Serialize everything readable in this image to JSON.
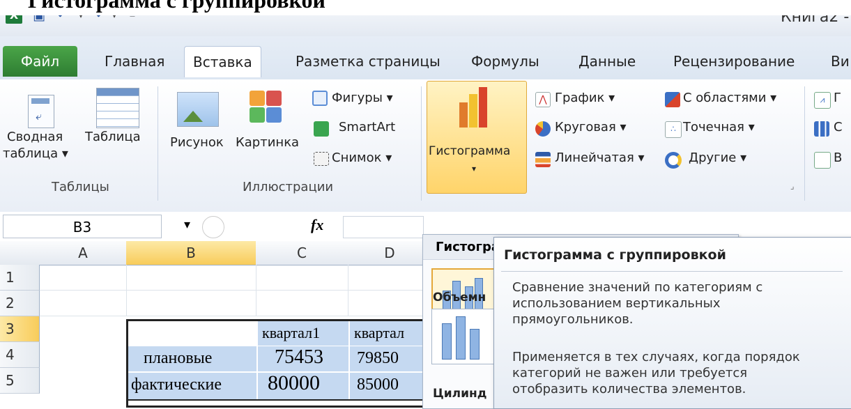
{
  "caption": "Гистограмма с группировкой",
  "titlebar": {
    "book_title": "Книга2 -"
  },
  "quick_access": {
    "icons": [
      "excel-logo-icon",
      "save-icon",
      "undo-icon",
      "redo-icon",
      "customize-icon"
    ]
  },
  "tabs": [
    {
      "label": "Файл"
    },
    {
      "label": "Главная"
    },
    {
      "label": "Вставка",
      "active": true
    },
    {
      "label": "Разметка страницы"
    },
    {
      "label": "Формулы"
    },
    {
      "label": "Данные"
    },
    {
      "label": "Рецензирование"
    },
    {
      "label": "Ви"
    }
  ],
  "ribbon": {
    "tables": {
      "pivot_line1": "Сводная",
      "pivot_line2": "таблица ▾",
      "table": "Таблица",
      "group": "Таблицы"
    },
    "illustrations": {
      "picture": "Рисунок",
      "clipart": "Картинка",
      "shapes": "Фигуры ▾",
      "smartart": "SmartArt",
      "screenshot": "Снимок ▾",
      "group": "Иллюстрации"
    },
    "charts": {
      "histogram": "Гистограмма",
      "histogram_arrow": "▾",
      "line": "График ▾",
      "pie": "Круговая ▾",
      "bar": "Линейчатая ▾",
      "area": "С областями ▾",
      "scatter": "Точечная ▾",
      "other": "Другие ▾",
      "dialog_launcher": "⌟"
    },
    "sparklines": {
      "item1": "Г",
      "item2": "С",
      "item3": "В"
    }
  },
  "formula_bar": {
    "name_box": "B3",
    "dropdown_arrow": "▾",
    "fx": "fx"
  },
  "grid": {
    "columns": [
      "A",
      "B",
      "C",
      "D"
    ],
    "rows": [
      "1",
      "2",
      "3",
      "4",
      "5"
    ],
    "table": {
      "header": [
        "квартал1",
        "квартал"
      ],
      "rows": [
        {
          "label": "плановые",
          "values": [
            "75453",
            "79850"
          ]
        },
        {
          "label": "фактические",
          "values": [
            "80000",
            "85000"
          ]
        }
      ]
    }
  },
  "dropdown": {
    "heading": "Гистограмма",
    "section2": "Объемн",
    "section3": "Цилинд"
  },
  "tooltip": {
    "title": "Гистограмма с группировкой",
    "p1": [
      "Сравнение значений по категориям с",
      "использованием вертикальных",
      "прямоугольников."
    ],
    "p2": [
      "Применяется в тех случаях, когда порядок",
      "категорий не важен или требуется",
      "отобразить количества элементов."
    ]
  },
  "colors": {
    "accent_green": "#2e7d32",
    "selection_gold": "#f8cc5a",
    "table_blue": "#c5d9f1"
  }
}
